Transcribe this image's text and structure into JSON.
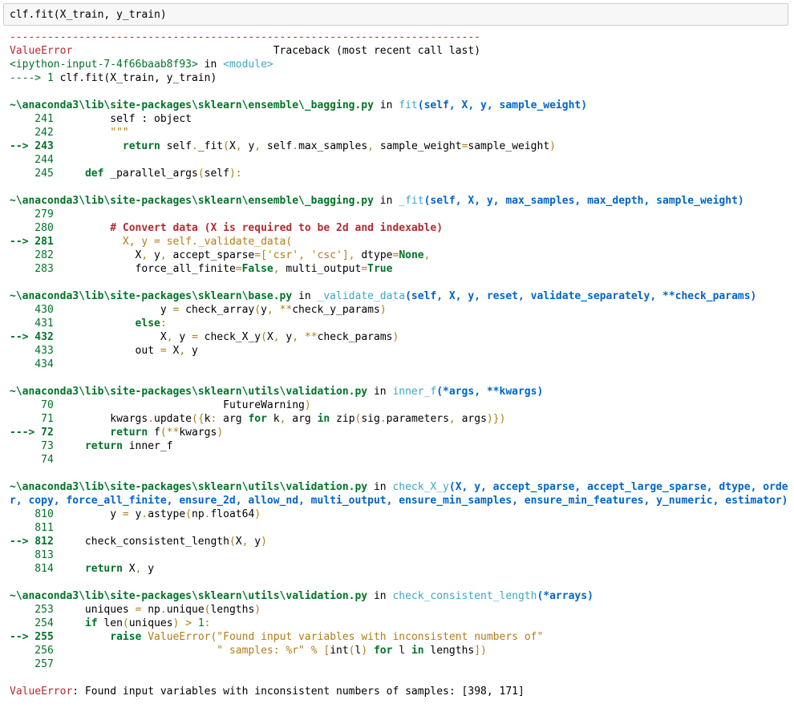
{
  "input_cell": {
    "code": "clf.fit(X_train, y_train)"
  },
  "traceback": {
    "rule": "---------------------------------------------------------------------------",
    "error_type": "ValueError",
    "header_right": "Traceback (most recent call last)",
    "input_ref": "<ipython-input-7-4f66baab8f93>",
    "in_word": "in",
    "module": "<module>",
    "first_arrow": "----> 1",
    "first_code": "clf.fit(X_train, y_train)",
    "frames": [
      {
        "path": "~\\anaconda3\\lib\\site-packages\\sklearn\\ensemble\\_bagging.py",
        "func": "fit",
        "args": "(self, X, y, sample_weight)"
      },
      {
        "path": "~\\anaconda3\\lib\\site-packages\\sklearn\\ensemble\\_bagging.py",
        "func": "_fit",
        "args": "(self, X, y, max_samples, max_depth, sample_weight)"
      },
      {
        "path": "~\\anaconda3\\lib\\site-packages\\sklearn\\base.py",
        "func": "_validate_data",
        "args": "(self, X, y, reset, validate_separately, **check_params)"
      },
      {
        "path": "~\\anaconda3\\lib\\site-packages\\sklearn\\utils\\validation.py",
        "func": "inner_f",
        "args": "(*args, **kwargs)"
      },
      {
        "path": "~\\anaconda3\\lib\\site-packages\\sklearn\\utils\\validation.py",
        "func": "check_X_y",
        "args": "(X, y, accept_sparse, accept_large_sparse, dtype, order, copy, force_all_finite, ensure_2d, allow_nd, multi_output, ensure_min_samples, ensure_min_features, y_numeric, estimator)"
      },
      {
        "path": "~\\anaconda3\\lib\\site-packages\\sklearn\\utils\\validation.py",
        "func": "check_consistent_length",
        "args": "(*arrays)"
      }
    ],
    "final_error_type": "ValueError",
    "final_message": ": Found input variables with inconsistent numbers of samples: [398, 171]"
  },
  "colors": {
    "red": "#b22b31",
    "green": "#007427",
    "blue": "#0065ca",
    "cyan": "#3ba7c4",
    "string": "#b27d12",
    "input_bg": "#f7f7f7"
  }
}
